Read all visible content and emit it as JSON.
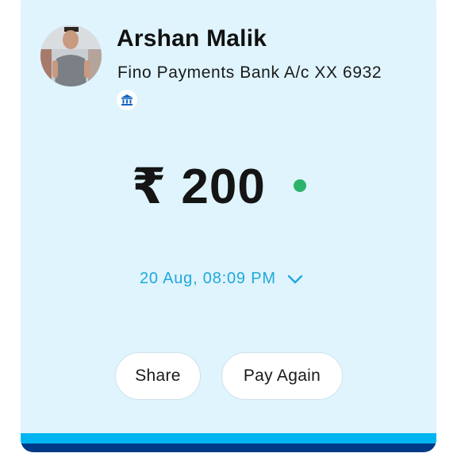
{
  "transaction": {
    "payee_name": "Arshan Malik",
    "bank_account": "Fino Payments Bank A/c XX 6932",
    "amount": "₹ 200",
    "datetime": "20 Aug, 08:09 PM"
  },
  "actions": {
    "share_label": "Share",
    "pay_again_label": "Pay Again"
  },
  "icons": {
    "bank": "bank-icon",
    "expand": "chevron-down-icon",
    "status": "status-dot"
  },
  "colors": {
    "card_background": "#dff4fd",
    "accent": "#1fa8dd",
    "status_success": "#2bb36b",
    "brand_light": "#00b4f0",
    "brand_dark": "#003a87"
  }
}
